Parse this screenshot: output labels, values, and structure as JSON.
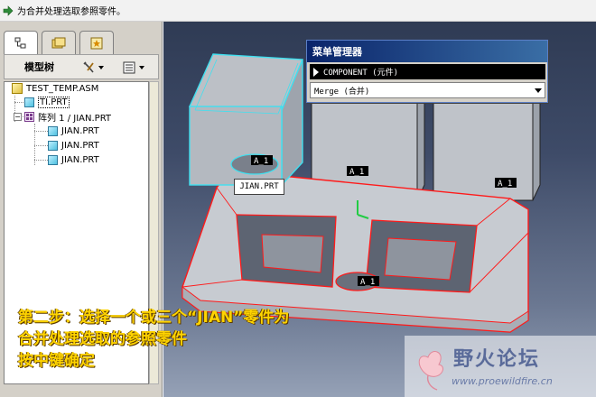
{
  "message_bar": {
    "icon": "arrow-prompt-icon",
    "text": "为合并处理选取参照零件。"
  },
  "left_panel": {
    "tabs": [
      {
        "icon": "model-tree-icon",
        "active": true
      },
      {
        "icon": "folder-browser-icon",
        "active": false
      },
      {
        "icon": "favorites-icon",
        "active": false
      }
    ],
    "header": {
      "title": "模型树",
      "settings_icon": "tree-settings-icon",
      "show_icon": "tree-show-icon"
    },
    "tree": [
      {
        "label": "TEST_TEMP.ASM",
        "type": "assembly",
        "level": 0
      },
      {
        "label": "TI.PRT",
        "type": "part",
        "level": 1,
        "selected": true
      },
      {
        "label": "阵列 1 / JIAN.PRT",
        "type": "pattern",
        "level": 1,
        "expanded": true
      },
      {
        "label": "JIAN.PRT",
        "type": "part",
        "level": 2
      },
      {
        "label": "JIAN.PRT",
        "type": "part",
        "level": 2
      },
      {
        "label": "JIAN.PRT",
        "type": "part",
        "level": 2
      }
    ]
  },
  "menu_manager": {
    "title": "菜单管理器",
    "item": "COMPONENT (元件)",
    "select_value": "Merge (合并)"
  },
  "viewport": {
    "tooltip": "JIAN.PRT",
    "csys_labels": [
      "A_1",
      "A_1",
      "A_1",
      "A_1"
    ]
  },
  "instruction": {
    "line1": "第二步：选择一个或三个“JIAN”零件为",
    "line2": "合并处理选取的参照零件",
    "line3": "按中键确定"
  },
  "watermark": {
    "name": "野火论坛",
    "url": "www.proewildfire.cn"
  },
  "colors": {
    "selection_red": "#ff1a1a",
    "preselect_cyan": "#3fe0f0",
    "instruction_yellow": "#ffd400",
    "title_blue": "#0a246a"
  }
}
